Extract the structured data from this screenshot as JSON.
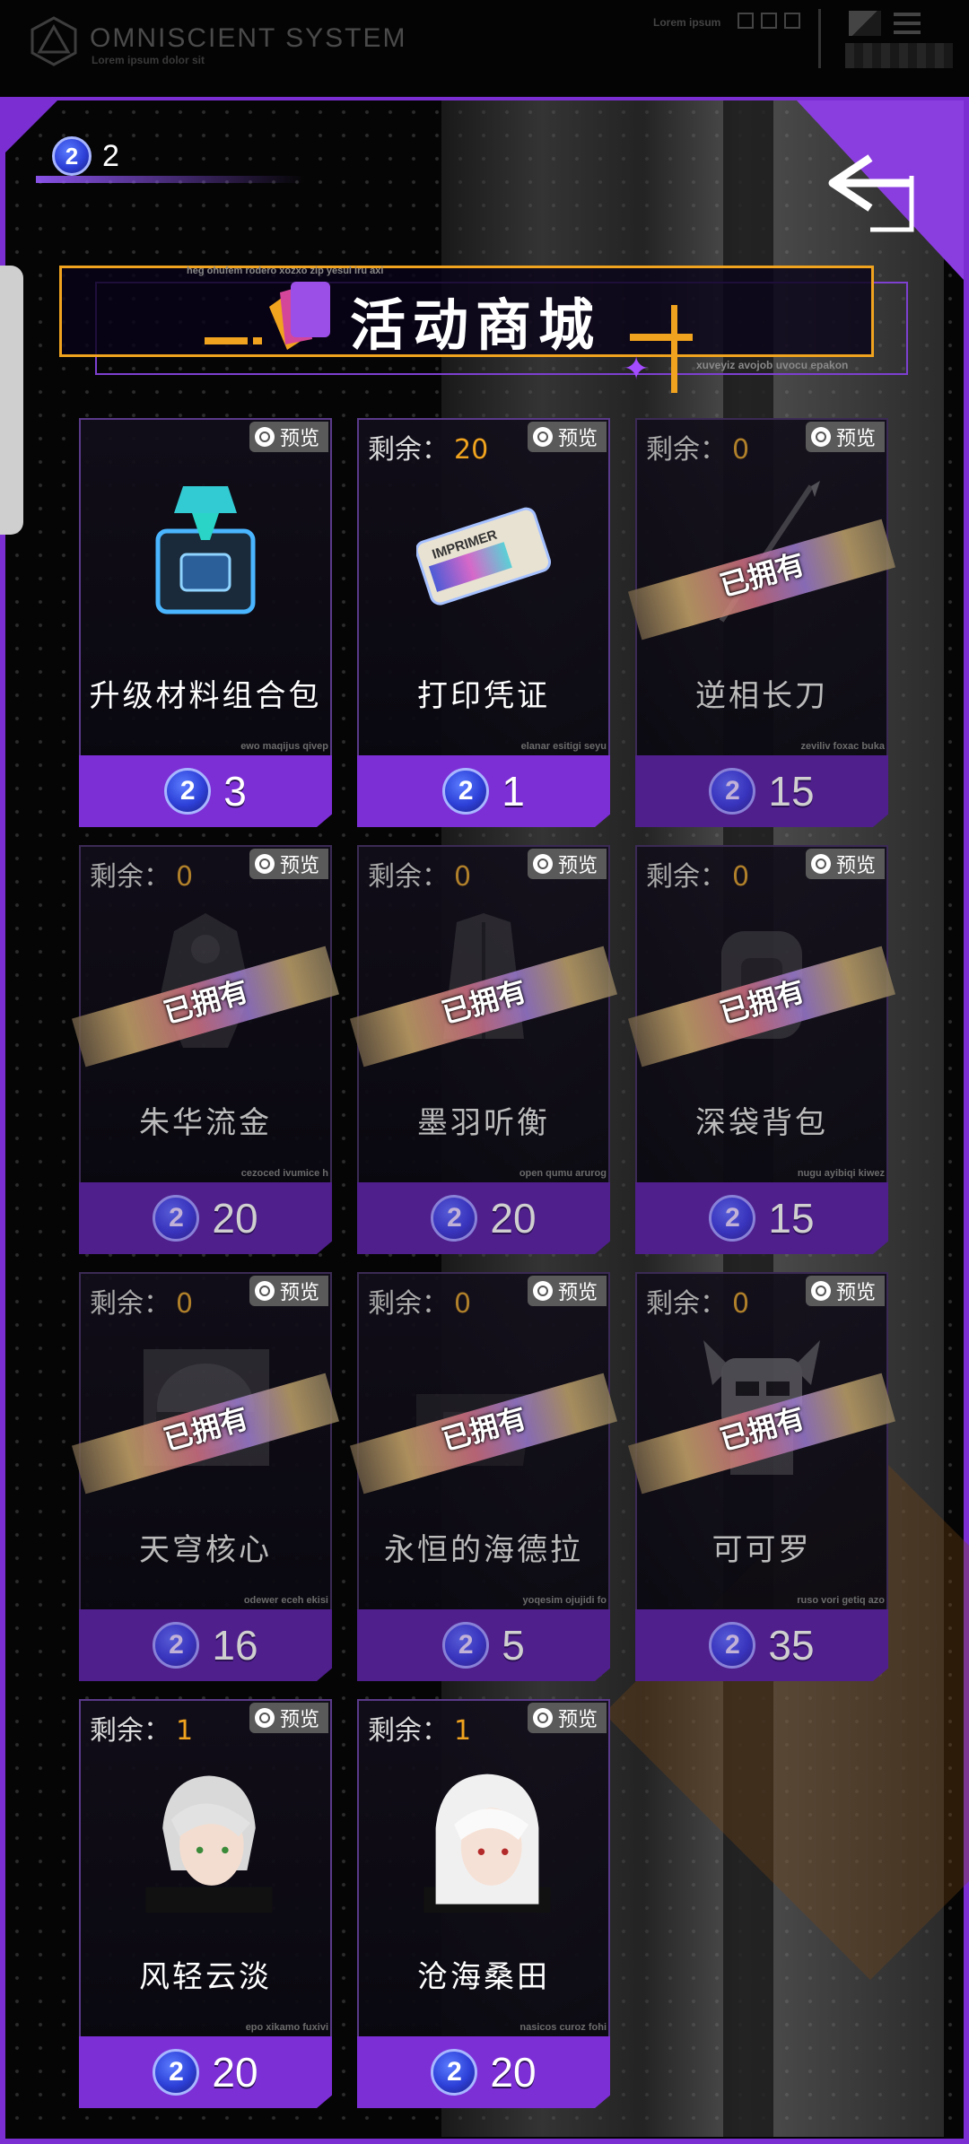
{
  "system_bar": {
    "title": "OMNISCIENT SYSTEM",
    "subtitle": "Lorem ipsum dolor sit",
    "right_text": "Lorem ipsum"
  },
  "currency": {
    "icon": "token-coin-icon",
    "coin_glyph": "2",
    "count": "2"
  },
  "banner": {
    "title": "活动商城",
    "tiny_top": "heg ohufem rodero xozxo zip yesul iru axi",
    "tiny_bottom": "xuveyiz avojob uvocu epakon"
  },
  "labels": {
    "remaining": "剩余：",
    "preview": "预览",
    "owned": "已拥有"
  },
  "items": [
    {
      "name": "升级材料组合包",
      "price": "3",
      "remaining": "",
      "owned": false,
      "tiny": "ewo maqijus qivep",
      "icon": "material-box-icon"
    },
    {
      "name": "打印凭证",
      "price": "1",
      "remaining": "20",
      "owned": false,
      "tiny": "elanar esitigi seyu",
      "icon": "imprimer-ticket-icon",
      "ticket_text": "IMPRIMER"
    },
    {
      "name": "逆相长刀",
      "price": "15",
      "remaining": "0",
      "owned": true,
      "tiny": "zeviliv foxac buka",
      "icon": "blade-icon"
    },
    {
      "name": "朱华流金",
      "price": "20",
      "remaining": "0",
      "owned": true,
      "tiny": "cezoced ivumice h",
      "icon": "outfit-icon"
    },
    {
      "name": "墨羽听衡",
      "price": "20",
      "remaining": "0",
      "owned": true,
      "tiny": "open qumu arurog",
      "icon": "coat-icon"
    },
    {
      "name": "深袋背包",
      "price": "15",
      "remaining": "0",
      "owned": true,
      "tiny": "nugu ayibiqi kiwez",
      "icon": "backpack-icon"
    },
    {
      "name": "天穹核心",
      "price": "16",
      "remaining": "0",
      "owned": true,
      "tiny": "odewer eceh ekisi",
      "icon": "core-icon"
    },
    {
      "name": "永恒的海德拉",
      "price": "5",
      "remaining": "0",
      "owned": true,
      "tiny": "yoqesim ojujidi fo",
      "icon": "hydra-icon"
    },
    {
      "name": "可可罗",
      "price": "35",
      "remaining": "0",
      "owned": true,
      "tiny": "ruso vori getiq azo",
      "icon": "robot-pet-icon"
    },
    {
      "name": "风轻云淡",
      "price": "20",
      "remaining": "1",
      "owned": false,
      "tiny": "epo xikamo fuxivi",
      "icon": "silver-hair-boy-portrait"
    },
    {
      "name": "沧海桑田",
      "price": "20",
      "remaining": "1",
      "owned": false,
      "tiny": "nasicos curoz fohi",
      "icon": "white-hair-girl-portrait"
    }
  ],
  "colors": {
    "accent_purple": "#7d2fd6",
    "accent_orange": "#f0a31e",
    "background": "#050505"
  }
}
